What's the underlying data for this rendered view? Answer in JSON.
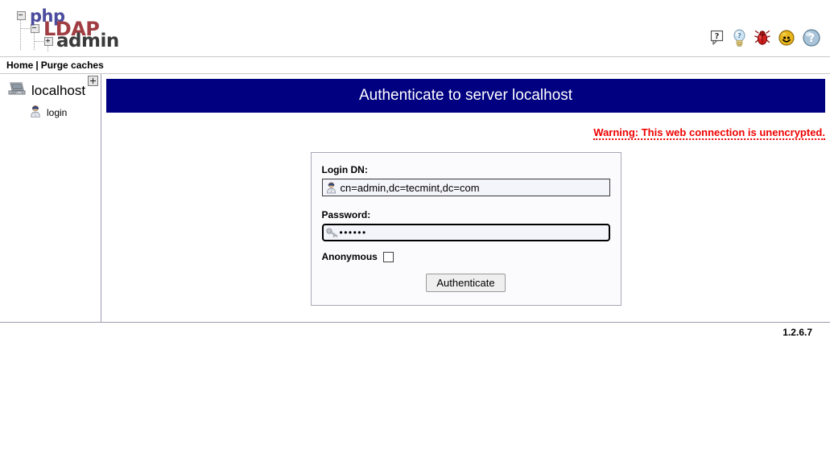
{
  "app": {
    "logo": {
      "word1": "php",
      "word2": "LDAP",
      "word3": "admin"
    },
    "version": "1.2.6.7"
  },
  "header": {
    "icons": [
      {
        "name": "question-bubble-icon",
        "title": "Help"
      },
      {
        "name": "lightbulb-icon",
        "title": "Hints"
      },
      {
        "name": "bug-icon",
        "title": "Report a bug"
      },
      {
        "name": "smiley-icon",
        "title": "Request a feature"
      },
      {
        "name": "question-ball-icon",
        "title": "Documentation"
      }
    ]
  },
  "navbar": {
    "home_label": "Home",
    "separator": "|",
    "purge_label": "Purge caches"
  },
  "sidebar": {
    "expand_label": "+",
    "server": {
      "label": "localhost",
      "icon": "server-computer-icon"
    },
    "children": [
      {
        "label": "login",
        "icon": "user-login-icon"
      }
    ]
  },
  "main": {
    "title": "Authenticate to server localhost",
    "warning": "Warning: This web connection is unencrypted.",
    "form": {
      "login_dn_label": "Login DN:",
      "login_dn_value": "cn=admin,dc=tecmint,dc=com",
      "login_dn_placeholder": "",
      "login_dn_icon": "user-icon",
      "password_label": "Password:",
      "password_value": "••••••",
      "password_placeholder": "",
      "password_icon": "key-icon",
      "anonymous_label": "Anonymous",
      "anonymous_checked": false,
      "submit_label": "Authenticate"
    }
  },
  "colors": {
    "title_bar_bg": "#000080",
    "warning_text": "#ee0000",
    "logo_php": "#4c4c9e",
    "logo_ldap": "#a03d42",
    "logo_admin": "#3a3a3a"
  }
}
